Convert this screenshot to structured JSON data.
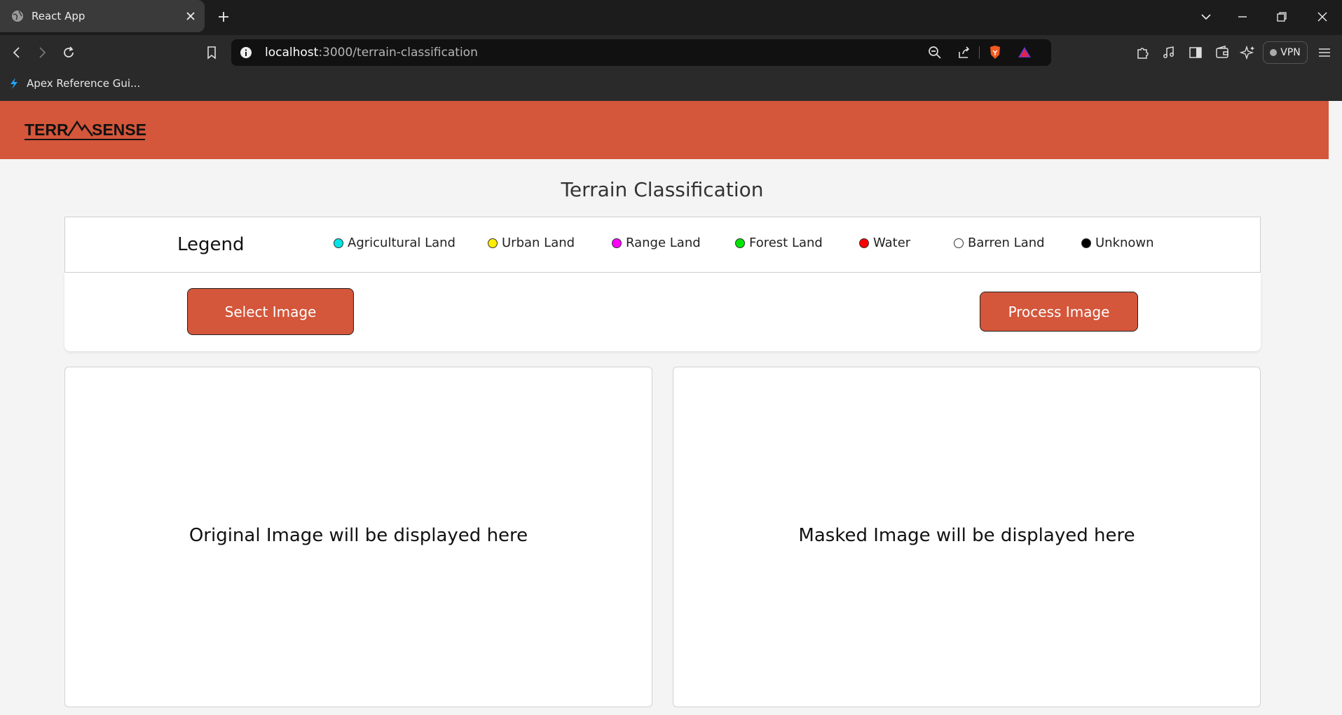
{
  "browser": {
    "tab_title": "React App",
    "url_host": "localhost",
    "url_path": ":3000/terrain-classification",
    "bookmark_label": "Apex Reference Gui...",
    "vpn_label": "VPN"
  },
  "app": {
    "logo_text": "TERRASENSE",
    "page_title": "Terrain Classification",
    "legend_title": "Legend",
    "legend_items": [
      {
        "label": "Agricultural Land",
        "color": "#00e5e5"
      },
      {
        "label": "Urban Land",
        "color": "#ffee00"
      },
      {
        "label": "Range Land",
        "color": "#ff00ff"
      },
      {
        "label": "Forest Land",
        "color": "#00e600"
      },
      {
        "label": "Water",
        "color": "#ff0000"
      },
      {
        "label": "Barren Land",
        "color": "#ffffff"
      },
      {
        "label": "Unknown",
        "color": "#000000"
      }
    ],
    "select_button": "Select Image",
    "process_button": "Process Image",
    "original_placeholder": "Original Image will be displayed here",
    "masked_placeholder": "Masked Image will be displayed here",
    "accent_color": "#d4563b"
  }
}
